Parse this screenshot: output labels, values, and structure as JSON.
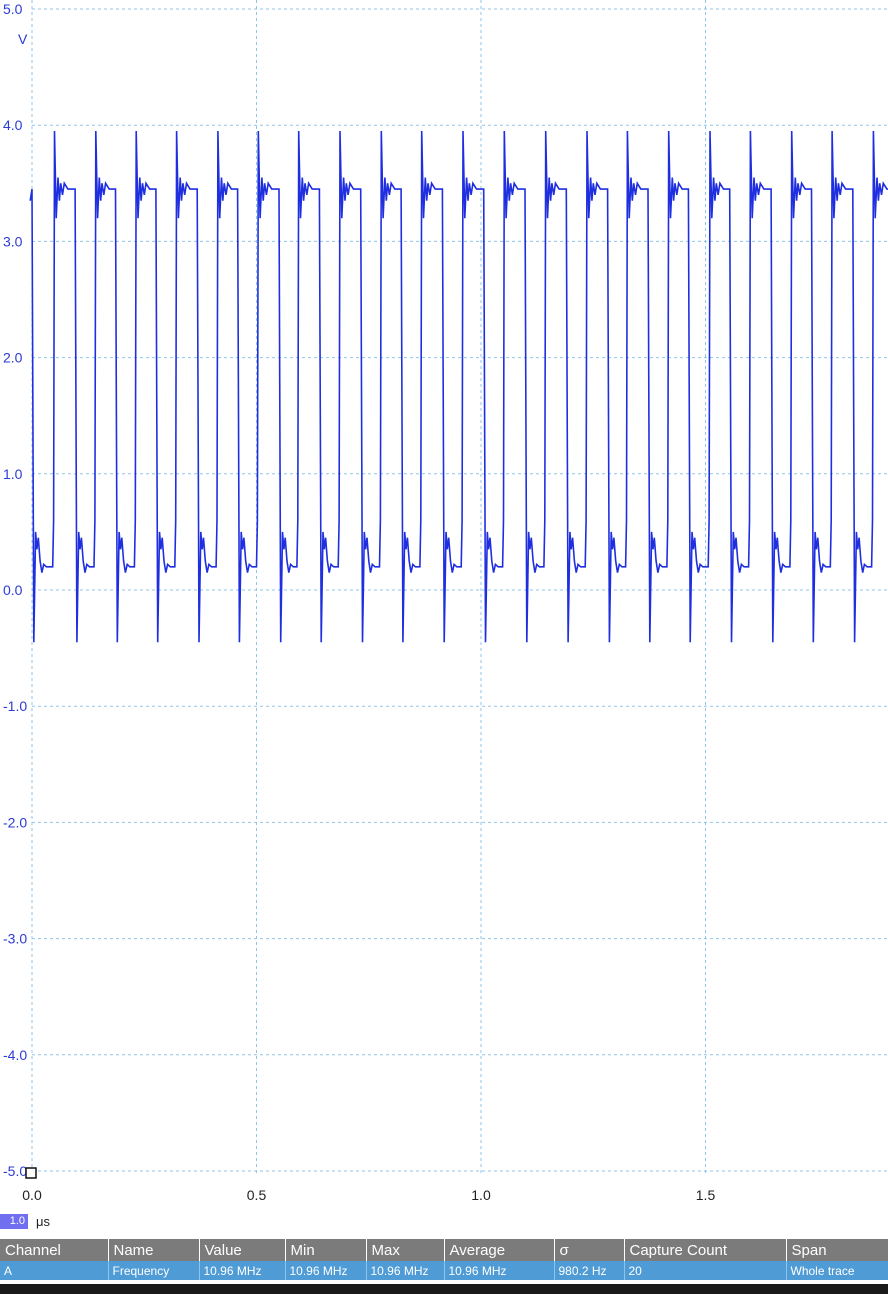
{
  "chart_data": {
    "type": "line",
    "title": "",
    "ylabel": "V",
    "xlabel": "μs",
    "ylim": [
      -5.0,
      5.0
    ],
    "xlim": [
      0.0,
      1.9
    ],
    "y_ticks": [
      "5.0",
      "4.0",
      "3.0",
      "2.0",
      "1.0",
      "0.0",
      "-1.0",
      "-2.0",
      "-3.0",
      "-4.0",
      "-5.0"
    ],
    "x_ticks": [
      "0.0",
      "0.5",
      "1.0",
      "1.5"
    ],
    "grid": true,
    "series": [
      {
        "color": "#1f2fe0",
        "waveform": "square",
        "frequency_mhz": 10.96,
        "high_v": 3.45,
        "low_v": 0.2,
        "overshoot_v": 3.95,
        "undershoot_v": -0.45,
        "rising_edges_us": [
          0.05,
          0.142,
          0.232,
          0.322,
          0.414,
          0.504,
          0.594,
          0.686,
          0.778,
          0.868,
          0.96,
          1.052,
          1.144,
          1.236,
          1.326,
          1.418,
          1.51,
          1.6,
          1.692,
          1.782,
          1.874
        ],
        "falling_edges_us": [
          0.0,
          0.096,
          0.186,
          0.276,
          0.368,
          0.458,
          0.55,
          0.64,
          0.732,
          0.822,
          0.914,
          1.006,
          1.098,
          1.19,
          1.282,
          1.372,
          1.462,
          1.554,
          1.646,
          1.736,
          1.828
        ]
      }
    ]
  },
  "timebase": {
    "value": "1.0",
    "unit": "μs"
  },
  "measurements": {
    "headers": [
      "Channel",
      "Name",
      "Value",
      "Min",
      "Max",
      "Average",
      "σ",
      "Capture Count",
      "Span"
    ],
    "rows": [
      [
        "A",
        "Frequency",
        "10.96 MHz",
        "10.96 MHz",
        "10.96 MHz",
        "10.96 MHz",
        "980.2 Hz",
        "20",
        "Whole trace"
      ]
    ]
  }
}
